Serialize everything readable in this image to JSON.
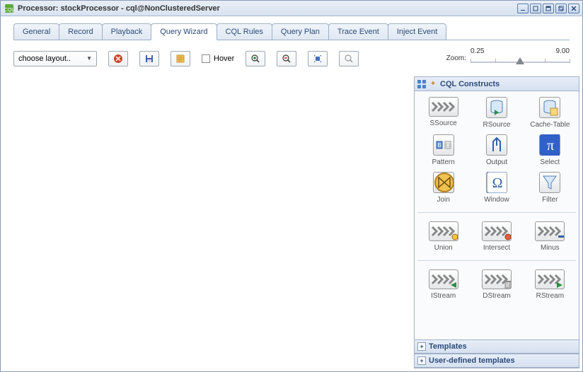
{
  "window": {
    "title": "Processor: stockProcessor - cql@NonClusteredServer"
  },
  "tabs": [
    "General",
    "Record",
    "Playback",
    "Query Wizard",
    "CQL Rules",
    "Query Plan",
    "Trace Event",
    "Inject Event"
  ],
  "active_tab_index": 3,
  "toolbar": {
    "layout_placeholder": "choose layout..",
    "hover_label": "Hover",
    "zoom_label": "Zoom:",
    "zoom_min": "0.25",
    "zoom_max": "9.00"
  },
  "side": {
    "panel1_title": "CQL Constructs",
    "panel2_title": "Templates",
    "panel3_title": "User-defined templates",
    "constructs": [
      {
        "label": "SSource",
        "icon": "chevrons"
      },
      {
        "label": "RSource",
        "icon": "db-in"
      },
      {
        "label": "Cache-Table",
        "icon": "db-cache"
      },
      {
        "label": "Pattern",
        "icon": "pattern"
      },
      {
        "label": "Output",
        "icon": "output"
      },
      {
        "label": "Select",
        "icon": "pi"
      },
      {
        "label": "Join",
        "icon": "bowtie"
      },
      {
        "label": "Window",
        "icon": "omega"
      },
      {
        "label": "Filter",
        "icon": "filter"
      },
      {
        "label": "Union",
        "icon": "chev-union"
      },
      {
        "label": "Intersect",
        "icon": "chev-intersect"
      },
      {
        "label": "Minus",
        "icon": "chev-minus"
      },
      {
        "label": "IStream",
        "icon": "chev-istream"
      },
      {
        "label": "DStream",
        "icon": "chev-dstream"
      },
      {
        "label": "RStream",
        "icon": "chev-rstream"
      }
    ]
  }
}
